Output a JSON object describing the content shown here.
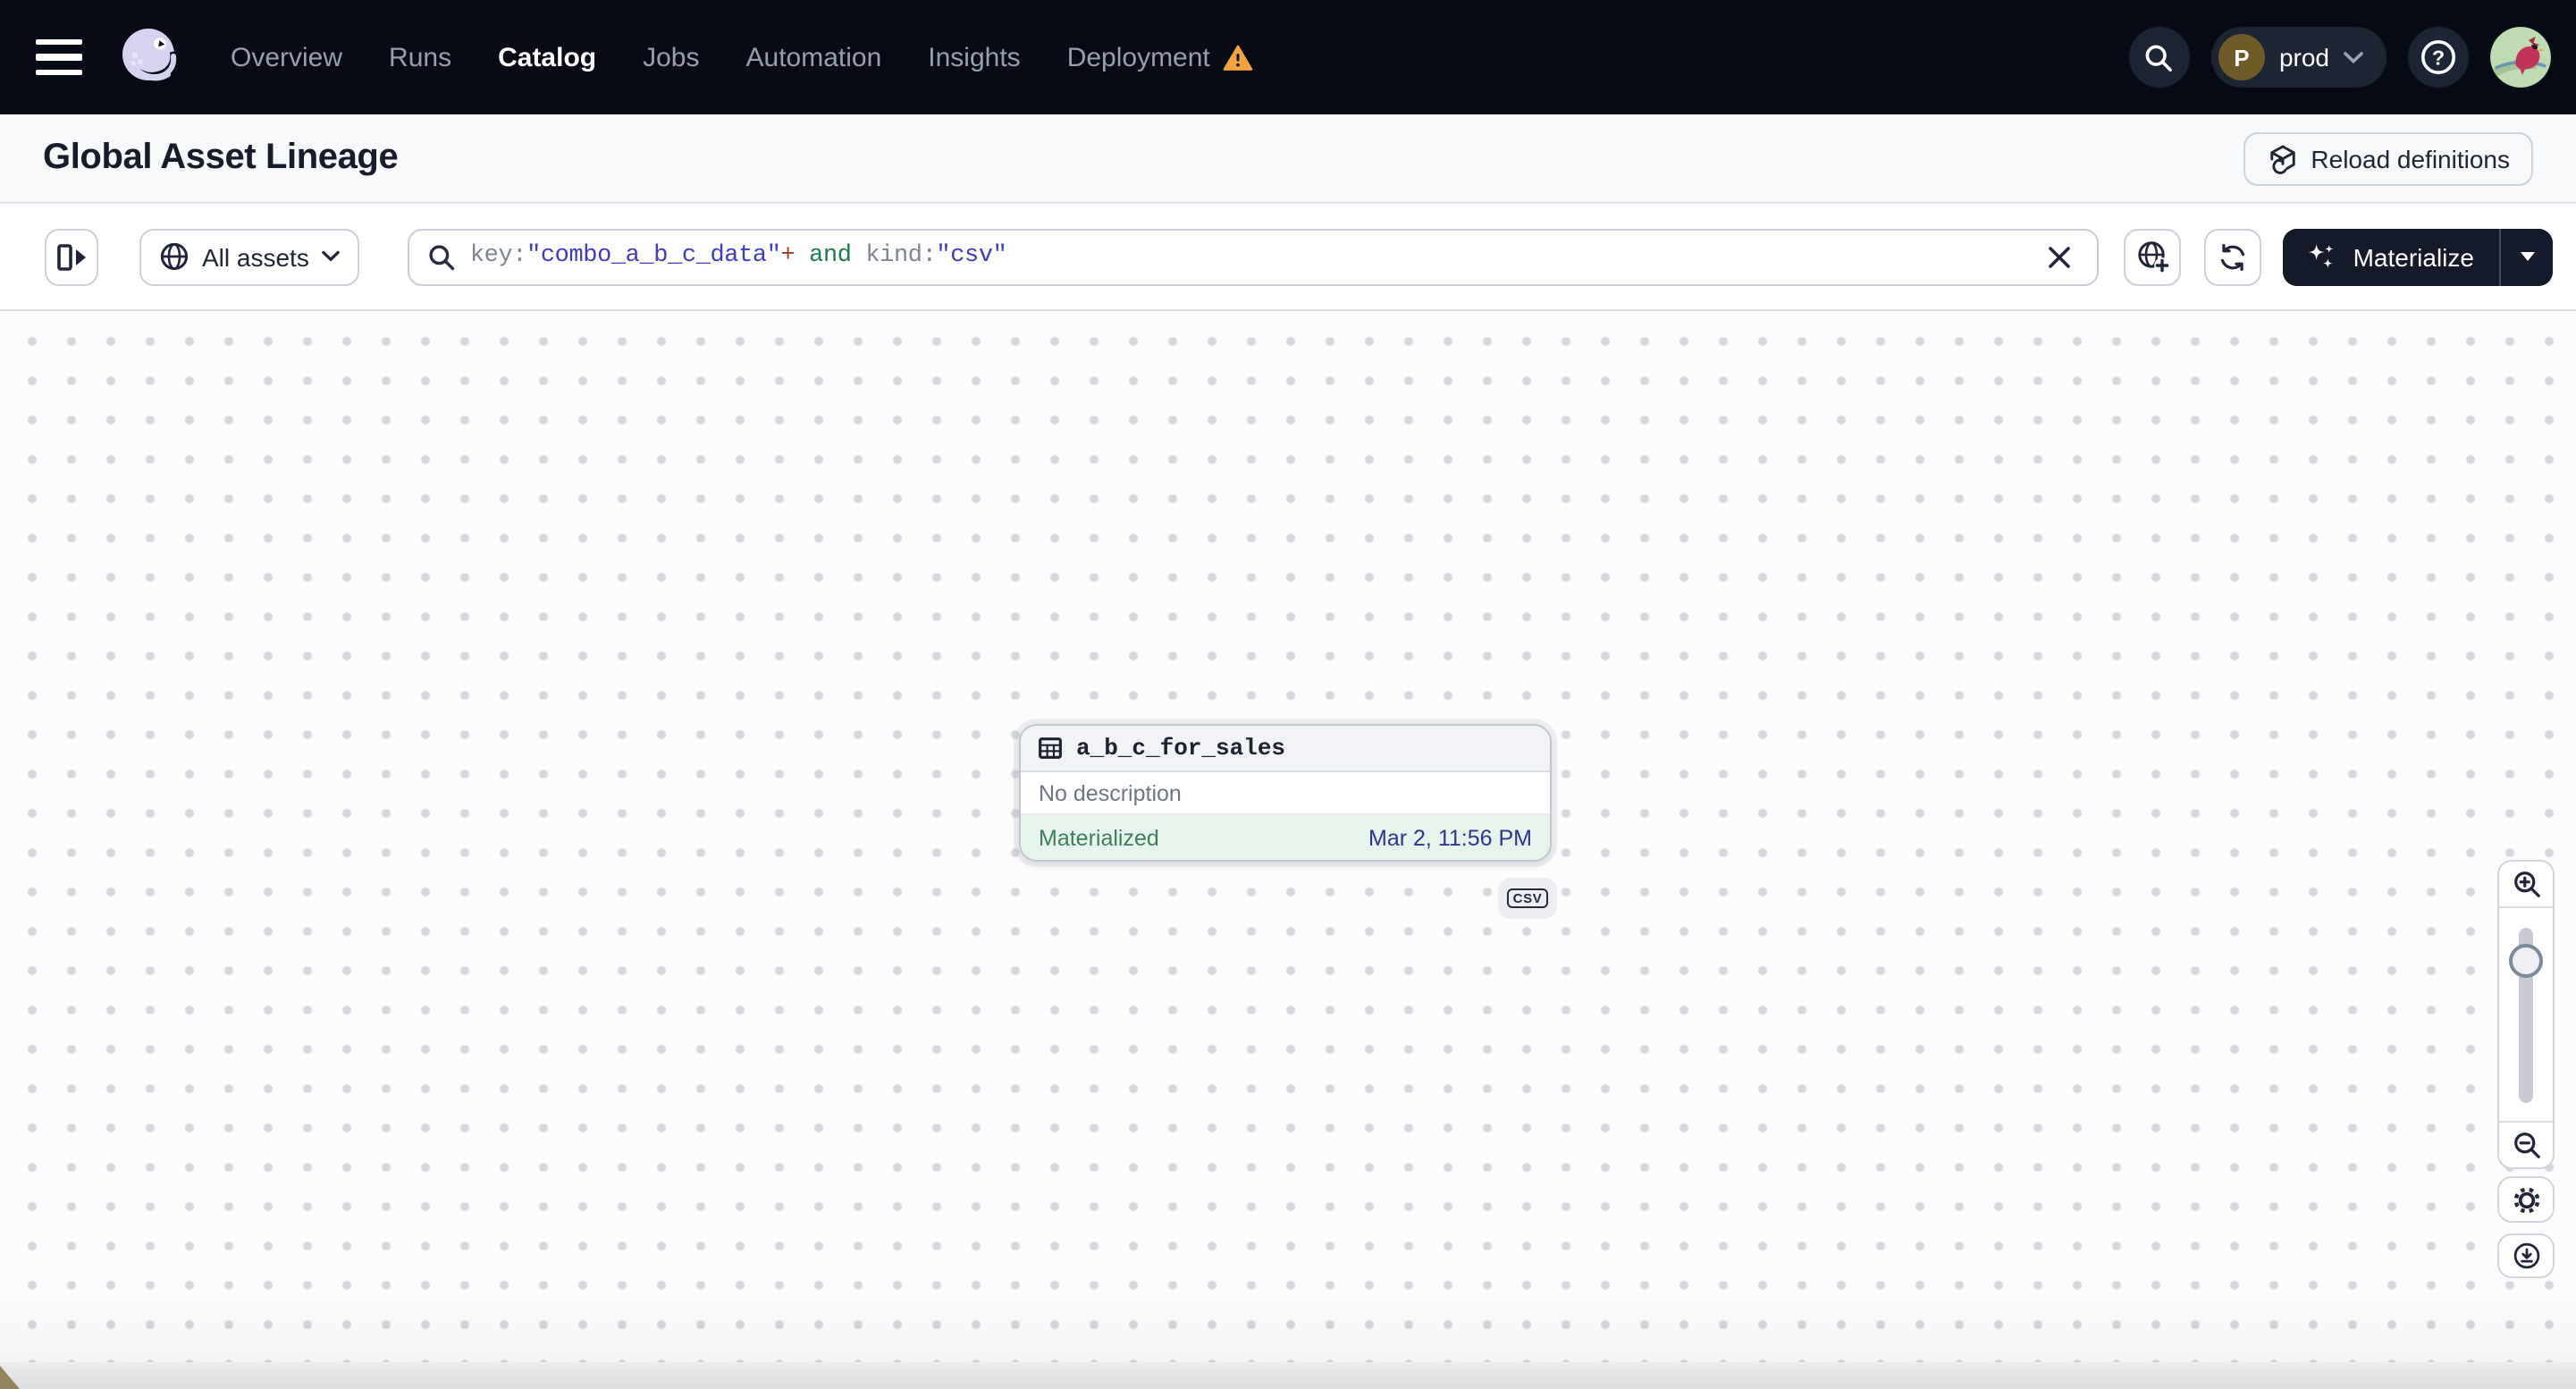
{
  "navbar": {
    "items": [
      "Overview",
      "Runs",
      "Catalog",
      "Jobs",
      "Automation",
      "Insights",
      "Deployment"
    ],
    "active_item": "Catalog",
    "deployment_has_warning": true,
    "environment": {
      "initial": "P",
      "name": "prod"
    }
  },
  "page": {
    "title": "Global Asset Lineage",
    "reload_button_label": "Reload definitions"
  },
  "toolbar": {
    "filter_label": "All assets",
    "search_query": "key:\"combo_a_b_c_data\"+ and kind:\"csv\"",
    "search_query_segments": [
      {
        "text": "key:",
        "color": "#7d8492"
      },
      {
        "text": "\"combo_a_b_c_data\"",
        "color": "#3f3cc4"
      },
      {
        "text": "+",
        "color": "#9e3a28"
      },
      {
        "text": " and ",
        "color": "#1e7b4a"
      },
      {
        "text": "kind:",
        "color": "#7d8492"
      },
      {
        "text": "\"csv\"",
        "color": "#3f3cc4"
      }
    ],
    "materialize_label": "Materialize"
  },
  "lineage": {
    "node": {
      "name": "a_b_c_for_sales",
      "description": "No description",
      "status": "Materialized",
      "last_materialization": "Mar 2, 11:56 PM",
      "kind_tag": "CSV"
    }
  },
  "colors": {
    "navbar_bg": "#070b15",
    "warning_orange": "#f2a43e",
    "materialized_green": "#3e7e5b",
    "materialized_bg": "#e7f4eb",
    "timestamp_indigo": "#31338f",
    "dark_button_bg": "#151a2b",
    "canvas_dot": "#d6d8de"
  },
  "icons": {
    "menu-icon": "≡",
    "dagster-logo": "octopus",
    "search-icon": "magnifier",
    "chevron-down-icon": "v",
    "help-icon": "?",
    "warning-icon": "⚠",
    "reload-icon": "cube-refresh",
    "panel-toggle-icon": "expand-right",
    "globe-icon": "globe",
    "clear-icon": "×",
    "globe-add-icon": "globe-plus",
    "refresh-icon": "sync-arrows",
    "sparkles-icon": "✦",
    "table-icon": "grid",
    "zoom-in-icon": "magnifier-plus",
    "zoom-out-icon": "magnifier-minus",
    "gear-icon": "⚙",
    "download-icon": "circle-arrow-down"
  }
}
